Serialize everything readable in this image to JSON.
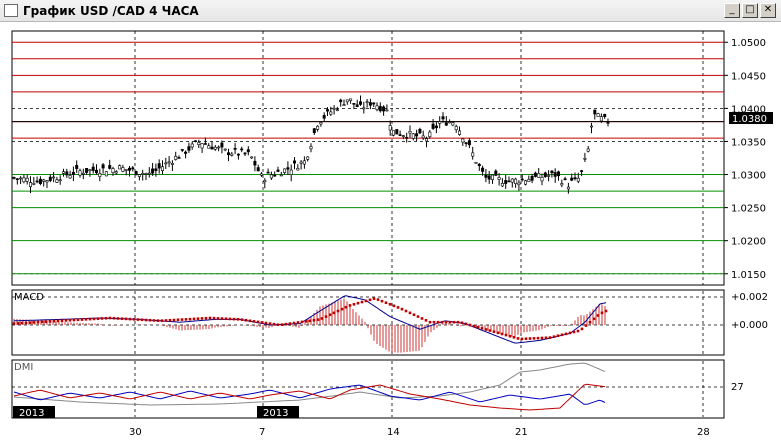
{
  "window": {
    "title": "График USD /CAD  4 ЧАСА",
    "buttons": {
      "minimize": "_",
      "maximize": "□",
      "close": "✕"
    }
  },
  "price_axis": {
    "labels": [
      "1.0500",
      "1.0450",
      "1.0400",
      "1.0350",
      "1.0300",
      "1.0250",
      "1.0200",
      "1.0150"
    ],
    "current": "1.0380",
    "current_bg": "#000000"
  },
  "macd": {
    "label": "MACD",
    "labels": [
      "+0.002",
      "+0.000"
    ]
  },
  "dmi": {
    "label": "DMI",
    "labels": [
      "27"
    ]
  },
  "year_tags": [
    "2013",
    "2013"
  ],
  "x_axis": {
    "labels": [
      "30",
      "7",
      "14",
      "21",
      "28"
    ]
  },
  "chart_data": [
    {
      "type": "candlestick",
      "title": "",
      "ylim": [
        1.0133,
        1.0517
      ],
      "levels_red": [
        1.05,
        1.0475,
        1.045,
        1.0425,
        1.038,
        1.0355
      ],
      "levels_green": [
        1.03,
        1.0275,
        1.025,
        1.02,
        1.015
      ],
      "colors": {
        "resistance": "#c00000",
        "support": "#009000",
        "candles": "#000000"
      }
    },
    {
      "type": "line",
      "label": "MACD",
      "ylim": [
        -0.0005,
        0.0025
      ],
      "colors": {
        "macd": "#00008c",
        "signal": "#c00000",
        "histogram": "#c00000"
      }
    },
    {
      "type": "line",
      "label": "DMI",
      "colors": {
        "plus_di": "#0000c0",
        "minus_di": "#c00000",
        "adx": "#808080"
      }
    }
  ]
}
